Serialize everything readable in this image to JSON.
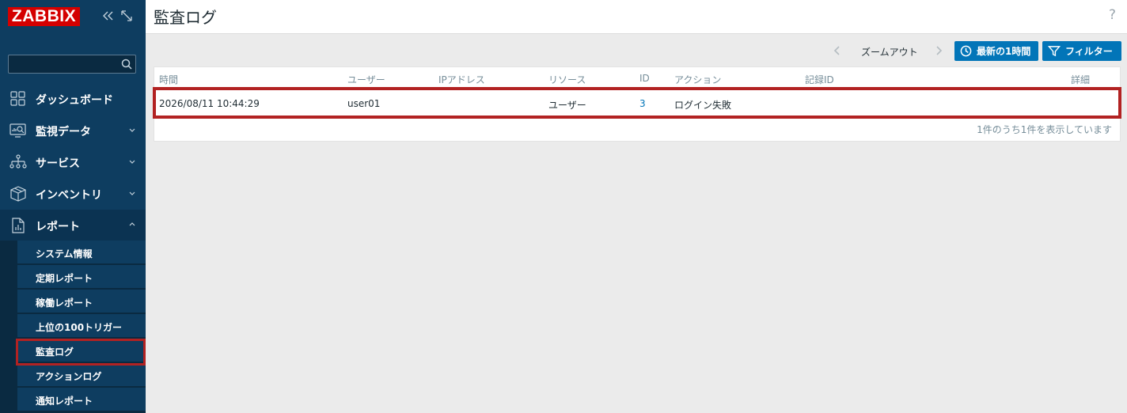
{
  "app": {
    "logo": "ZABBIX"
  },
  "search": {
    "placeholder": ""
  },
  "nav": {
    "dashboard": "ダッシュボード",
    "monitoring": "監視データ",
    "services": "サービス",
    "inventory": "インベントリ",
    "reports": "レポート"
  },
  "reports_menu": [
    "システム情報",
    "定期レポート",
    "稼働レポート",
    "上位の100トリガー",
    "監査ログ",
    "アクションログ",
    "通知レポート"
  ],
  "page": {
    "title": "監査ログ",
    "help": "?"
  },
  "filter_bar": {
    "zoom_out": "ズームアウト",
    "time_button": "最新の1時間",
    "filter_button": "フィルター"
  },
  "table": {
    "headers": [
      "時間",
      "ユーザー",
      "IPアドレス",
      "リソース",
      "ID",
      "アクション",
      "記録ID",
      "詳細"
    ],
    "rows": [
      {
        "time": "2026/08/11 10:44:29",
        "user": "user01",
        "ip": "",
        "resource": "ユーザー",
        "id": "3",
        "action": "ログイン失敗",
        "record_id": "",
        "details": ""
      }
    ],
    "footer": "1件のうち1件を表示しています"
  },
  "colors": {
    "sidebar": "#0e3d60",
    "accent": "#0275b8",
    "logo": "#d40000",
    "highlight": "#b22222"
  }
}
